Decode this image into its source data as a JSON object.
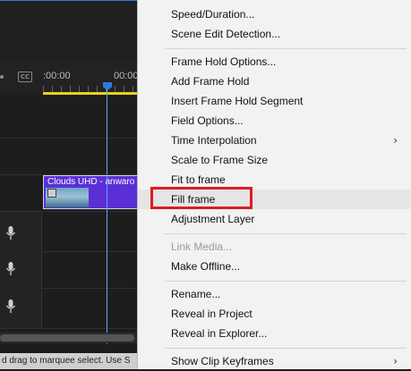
{
  "timeline": {
    "cc_label": "CC",
    "timecodes": [
      ":00:00",
      "00:00"
    ],
    "clip_label": "Clouds UHD - anwaro",
    "status_text": "d drag to marquee select. Use S"
  },
  "menu": {
    "items": [
      {
        "label": "Speed/Duration...",
        "disabled": false
      },
      {
        "label": "Scene Edit Detection...",
        "disabled": false
      },
      {
        "label": "Frame Hold Options...",
        "disabled": false
      },
      {
        "label": "Add Frame Hold",
        "disabled": false
      },
      {
        "label": "Insert Frame Hold Segment",
        "disabled": false
      },
      {
        "label": "Field Options...",
        "disabled": false
      },
      {
        "label": "Time Interpolation",
        "disabled": false,
        "submenu": true
      },
      {
        "label": "Scale to Frame Size",
        "disabled": false
      },
      {
        "label": "Fit to frame",
        "disabled": false
      },
      {
        "label": "Fill frame",
        "disabled": false,
        "highlighted": true
      },
      {
        "label": "Adjustment Layer",
        "disabled": false
      },
      {
        "label": "Link Media...",
        "disabled": true
      },
      {
        "label": "Make Offline...",
        "disabled": false
      },
      {
        "label": "Rename...",
        "disabled": false
      },
      {
        "label": "Reveal in Project",
        "disabled": false
      },
      {
        "label": "Reveal in Explorer...",
        "disabled": false
      },
      {
        "label": "Show Clip Keyframes",
        "disabled": false,
        "submenu": true
      }
    ],
    "submenu_arrow": "›"
  },
  "colors": {
    "highlight_box": "#e01a22",
    "clip": "#5b2fd6",
    "playhead": "#2f7bd8",
    "work_area_bar": "#e8d21b"
  }
}
